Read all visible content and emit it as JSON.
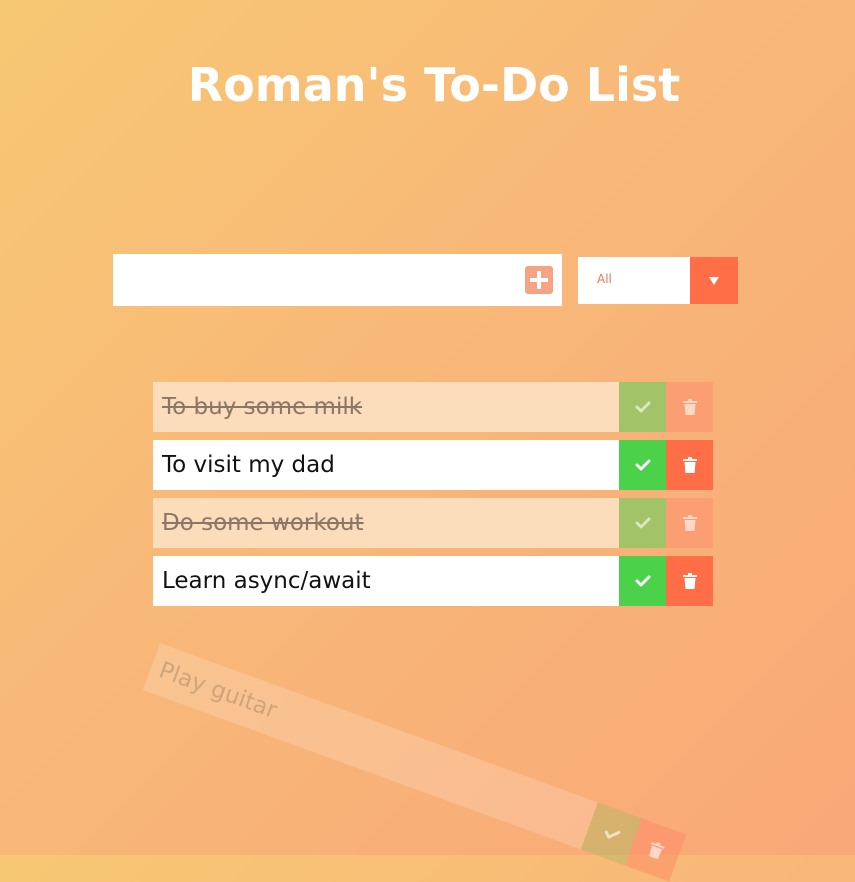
{
  "app": {
    "title": "Roman's To-Do List"
  },
  "form": {
    "input_value": "",
    "input_placeholder": "",
    "add_icon": "plus-square-icon"
  },
  "filter": {
    "selected": "All",
    "arrow_icon": "caret-down-icon"
  },
  "todos": [
    {
      "text": "To buy some milk",
      "completed": true
    },
    {
      "text": "To visit my dad",
      "completed": false
    },
    {
      "text": "Do some workout",
      "completed": true
    },
    {
      "text": "Learn async/await",
      "completed": false
    }
  ],
  "removing_todo": {
    "text": "Play guitar",
    "state": "falling-out"
  },
  "icons": {
    "complete": "check-icon",
    "delete": "trash-icon"
  },
  "colors": {
    "accent": "#ff6e46",
    "complete_green": "#4bd14a",
    "add_button": "#f4a384",
    "background_start": "#f7c873",
    "background_end": "#f9a877"
  }
}
